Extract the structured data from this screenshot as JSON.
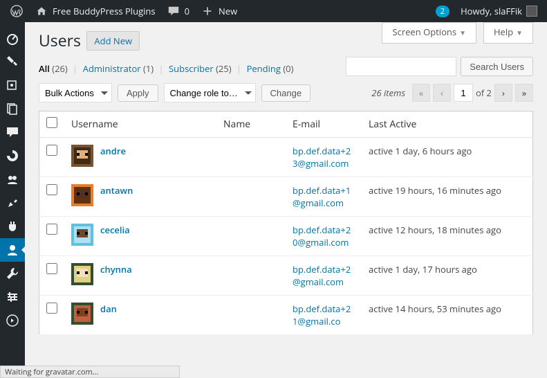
{
  "adminbar": {
    "site_title": "Free BuddyPress Plugins",
    "comments": "0",
    "new_label": "New",
    "notif_count": "2",
    "howdy": "Howdy, slaFFik"
  },
  "page": {
    "title": "Users",
    "add_new": "Add New",
    "screen_options": "Screen Options",
    "help": "Help"
  },
  "filters": {
    "all": {
      "label": "All",
      "count": "(26)"
    },
    "admin": {
      "label": "Administrator",
      "count": "(1)"
    },
    "subscriber": {
      "label": "Subscriber",
      "count": "(25)"
    },
    "pending": {
      "label": "Pending",
      "count": "(0)"
    }
  },
  "search": {
    "button": "Search Users",
    "value": ""
  },
  "bulk": {
    "bulk_actions": "Bulk Actions",
    "apply": "Apply",
    "change_role": "Change role to…",
    "change": "Change"
  },
  "pagination": {
    "items_label": "26 items",
    "page": "1",
    "of_label": "of 2"
  },
  "columns": {
    "username": "Username",
    "name": "Name",
    "email": "E-mail",
    "last_active": "Last Active"
  },
  "users": [
    {
      "username": "andre",
      "name": "",
      "email": "bp.def.data+23@gmail.com",
      "last_active": "active 1 day, 6 hours ago"
    },
    {
      "username": "antawn",
      "name": "",
      "email": "bp.def.data+1@gmail.com",
      "last_active": "active 19 hours, 16 minutes ago"
    },
    {
      "username": "cecelia",
      "name": "",
      "email": "bp.def.data+20@gmail.com",
      "last_active": "active 12 hours, 18 minutes ago"
    },
    {
      "username": "chynna",
      "name": "",
      "email": "bp.def.data+2@gmail.com",
      "last_active": "active 1 day, 17 hours ago"
    },
    {
      "username": "dan",
      "name": "",
      "email": "bp.def.data+21@gmail.co",
      "last_active": "active 14 hours, 53 minutes ago"
    }
  ],
  "avatar_colors": [
    [
      "#7a5230",
      "#402a12",
      "#e0b080"
    ],
    [
      "#e08030",
      "#603010",
      "#503020"
    ],
    [
      "#60c0e0",
      "#b0e0f0",
      "#704830"
    ],
    [
      "#305030",
      "#e0d080",
      "#f0e0c0"
    ],
    [
      "#305030",
      "#c06040",
      "#804020"
    ]
  ],
  "statusbar": "Waiting for gravatar.com..."
}
